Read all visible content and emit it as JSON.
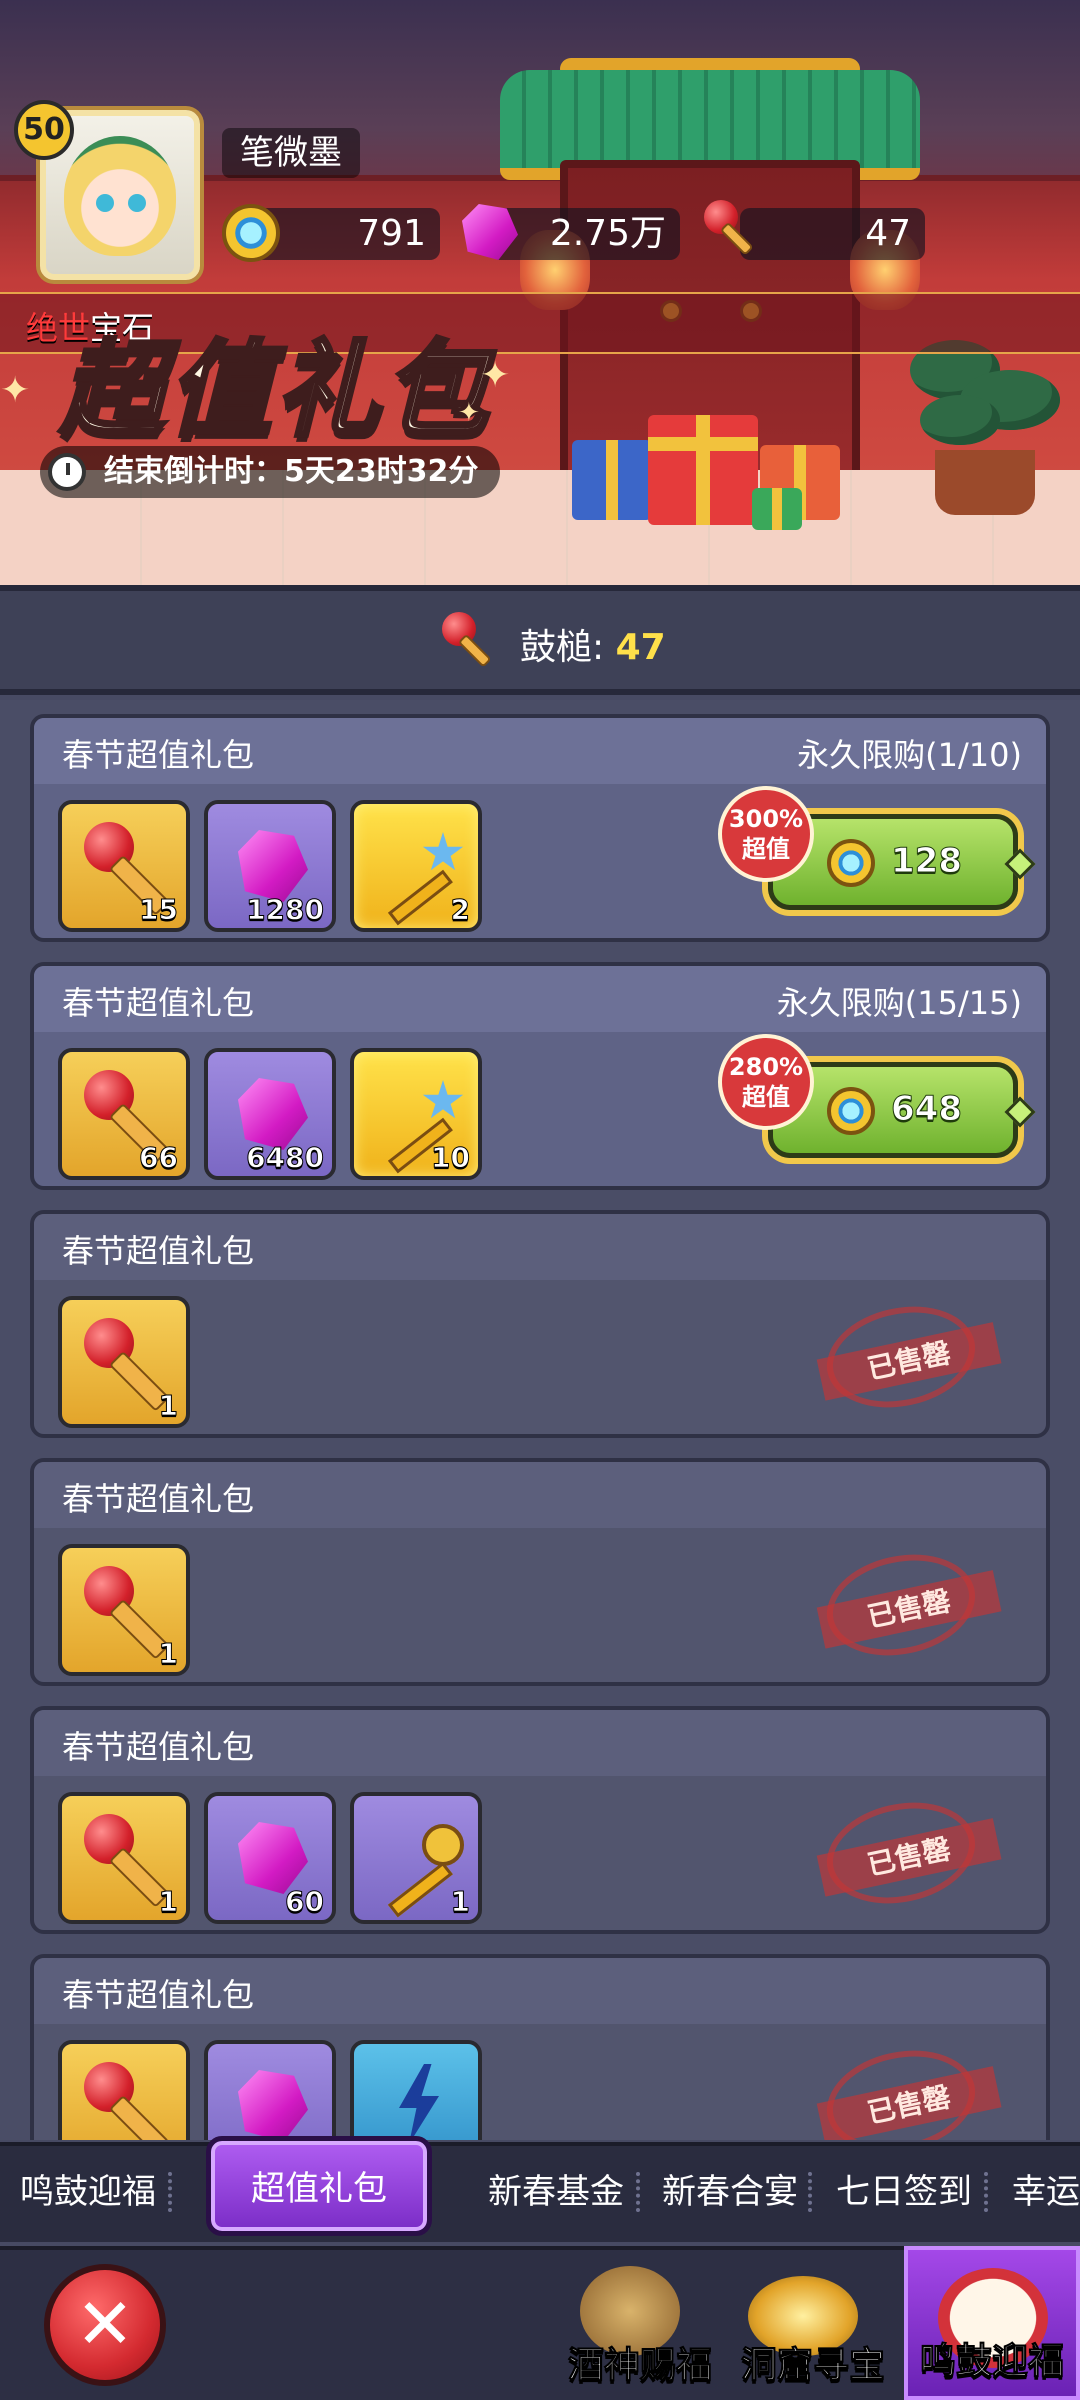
{
  "player": {
    "level": "50",
    "name": "笔微墨"
  },
  "resources": {
    "coins": "791",
    "gems": "2.75万",
    "mallets": "47"
  },
  "marquee": {
    "highlight": "绝世",
    "text": "宝石"
  },
  "banner": {
    "title": "超值礼包",
    "countdown": "结束倒计时：5天23时32分"
  },
  "currency": {
    "label": "鼓槌:",
    "value": "47"
  },
  "packages": [
    {
      "title": "春节超值礼包",
      "limit": "永久限购(1/10)",
      "badge_pct": "300%",
      "badge_text": "超值",
      "price": "128",
      "items": [
        {
          "icon": "mallet-icon",
          "count": "15"
        },
        {
          "icon": "gem-icon",
          "count": "1280"
        },
        {
          "icon": "star-key-icon",
          "count": "2"
        }
      ]
    },
    {
      "title": "春节超值礼包",
      "limit": "永久限购(15/15)",
      "badge_pct": "280%",
      "badge_text": "超值",
      "price": "648",
      "items": [
        {
          "icon": "mallet-icon",
          "count": "66"
        },
        {
          "icon": "gem-icon",
          "count": "6480"
        },
        {
          "icon": "star-key-icon",
          "count": "10"
        }
      ]
    },
    {
      "title": "春节超值礼包",
      "sold": "已售罄",
      "items": [
        {
          "icon": "mallet-icon",
          "count": "1"
        }
      ]
    },
    {
      "title": "春节超值礼包",
      "sold": "已售罄",
      "items": [
        {
          "icon": "mallet-icon",
          "count": "1"
        }
      ]
    },
    {
      "title": "春节超值礼包",
      "sold": "已售罄",
      "items": [
        {
          "icon": "mallet-icon",
          "count": "1"
        },
        {
          "icon": "gem-icon",
          "count": "60"
        },
        {
          "icon": "gold-key-icon",
          "count": "1"
        }
      ]
    },
    {
      "title": "春节超值礼包",
      "sold": "已售罄",
      "items": [
        {
          "icon": "mallet-icon",
          "count": ""
        },
        {
          "icon": "gem-icon",
          "count": ""
        },
        {
          "icon": "lightning-icon",
          "count": ""
        }
      ]
    }
  ],
  "tabs": [
    "鸣鼓迎福",
    "超值礼包",
    "新春基金",
    "新春合宴",
    "七日签到",
    "幸运"
  ],
  "active_tab": "超值礼包",
  "nav": [
    {
      "label": "酒神赐福"
    },
    {
      "label": "洞窟寻宝"
    },
    {
      "label": "鸣鼓迎福"
    }
  ]
}
